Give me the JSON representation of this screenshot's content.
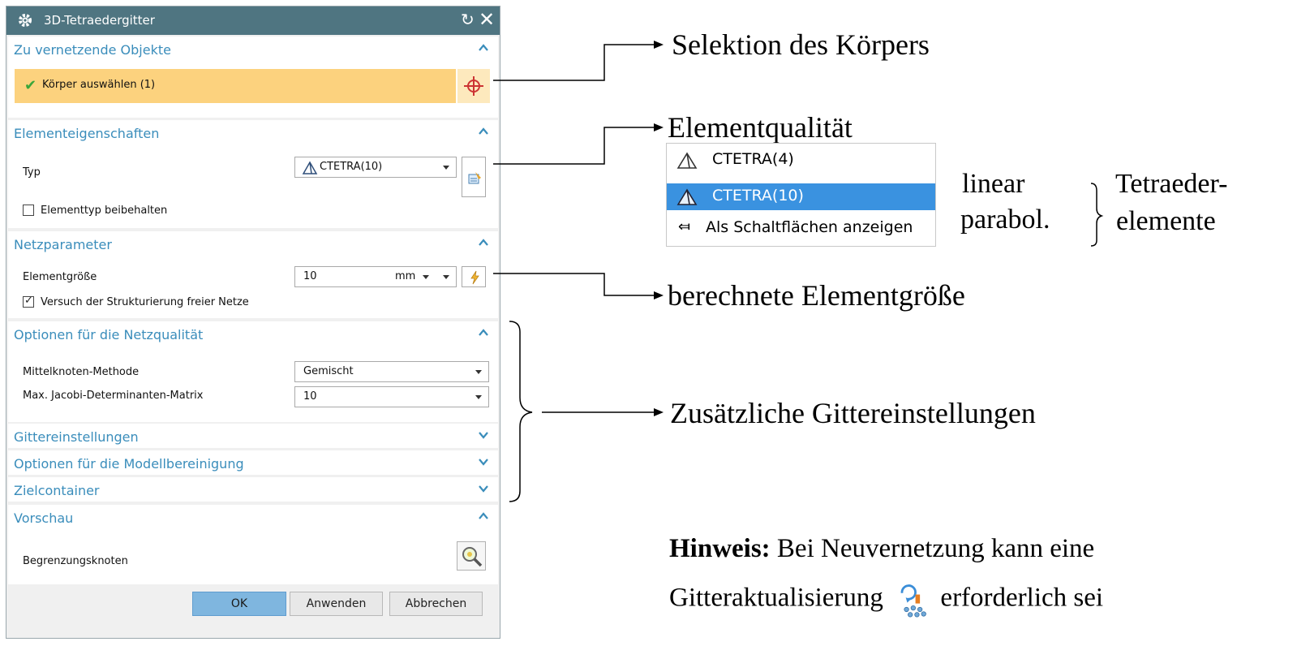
{
  "dialog": {
    "title": "3D-Tetraedergitter",
    "sections": {
      "objects": {
        "title": "Zu vernetzende Objekte",
        "select_label": "Körper auswählen (1)"
      },
      "properties": {
        "title": "Elementeigenschaften",
        "type_label": "Typ",
        "type_value": "CTETRA(10)",
        "keep_type_label": "Elementtyp beibehalten"
      },
      "mesh": {
        "title": "Netzparameter",
        "size_label": "Elementgröße",
        "size_value": "10",
        "size_unit": "mm",
        "structure_label": "Versuch der Strukturierung freier Netze"
      },
      "quality": {
        "title": "Optionen für die Netzqualität",
        "midnode_label": "Mittelknoten-Methode",
        "midnode_value": "Gemischt",
        "jacobi_label": "Max. Jacobi-Determinanten-Matrix",
        "jacobi_value": "10"
      },
      "grid": {
        "title": "Gittereinstellungen"
      },
      "cleanup": {
        "title": "Optionen für die Modellbereinigung"
      },
      "container": {
        "title": "Zielcontainer"
      },
      "preview": {
        "title": "Vorschau",
        "boundary_label": "Begrenzungsknoten"
      }
    },
    "buttons": {
      "ok": "OK",
      "apply": "Anwenden",
      "cancel": "Abbrechen"
    }
  },
  "annotations": {
    "selection": "Selektion des Körpers",
    "quality": "Elementqualität",
    "size": "berechnete Elementgröße",
    "additional": "Zusätzliche Gittereinstellungen",
    "linear": "linear",
    "parabol": "parabol.",
    "tetra_1": "Tetraeder-",
    "tetra_2": "elemente",
    "note_bold": "Hinweis:",
    "note_rest": " Bei Neuvernetzung kann eine",
    "note_line2a": "Gitteraktualisierung",
    "note_line2b": "erforderlich sei"
  },
  "dropdown": {
    "items": [
      "CTETRA(4)",
      "CTETRA(10)",
      "Als Schaltflächen anzeigen"
    ]
  }
}
